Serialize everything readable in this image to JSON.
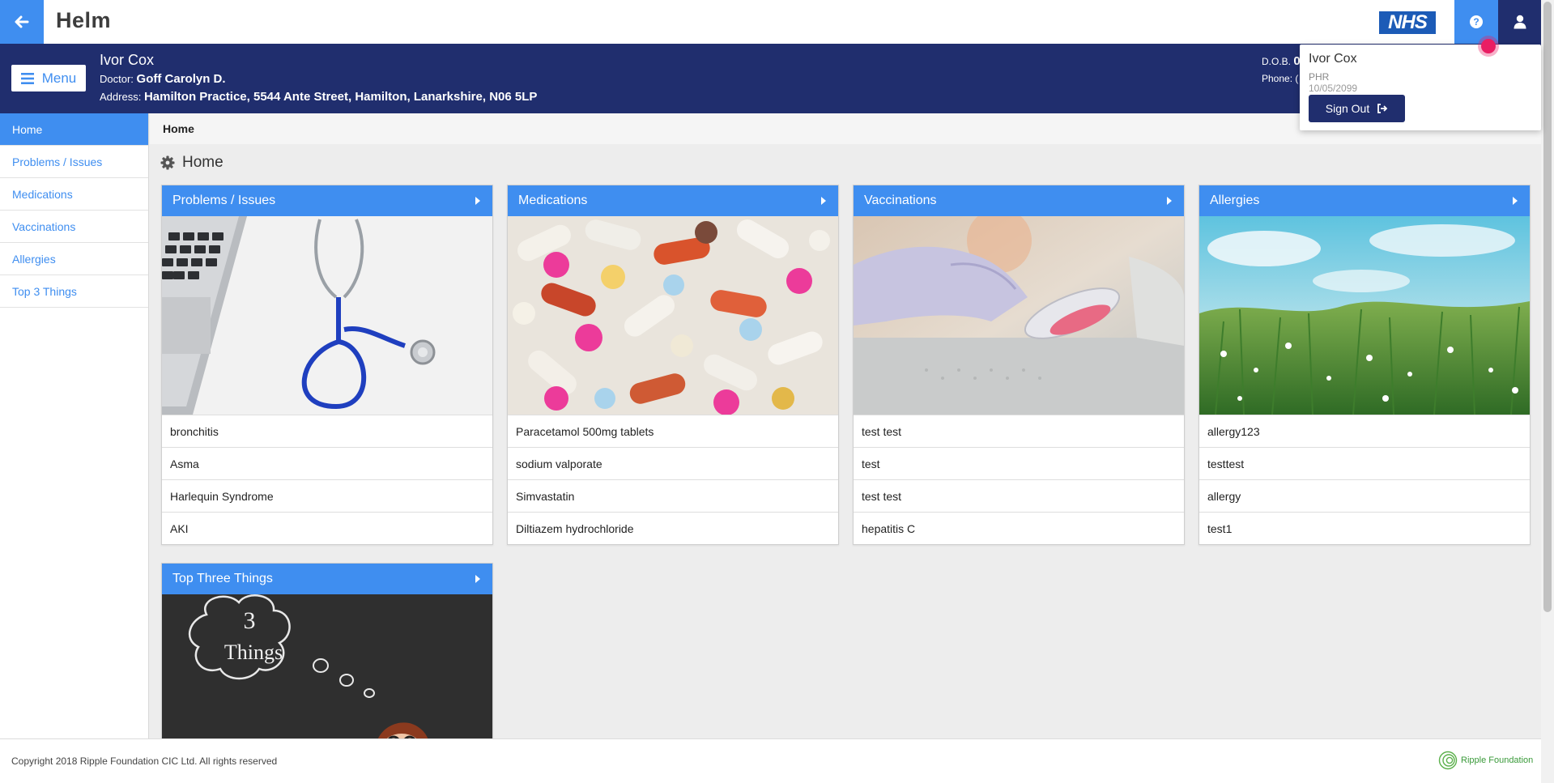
{
  "app": {
    "title": "Helm",
    "logo_text": "NHS"
  },
  "colors": {
    "primary": "#3f8ef0",
    "banner": "#202e6e",
    "accent_dot": "#e91e63"
  },
  "patient": {
    "name": "Ivor Cox",
    "doctor_label": "Doctor:",
    "doctor": "Goff Carolyn D.",
    "address_label": "Address:",
    "address": "Hamilton Practice, 5544 Ante Street, Hamilton, Lanarkshire, N06 5LP",
    "dob_label": "D.O.B.",
    "dob_partial": "0",
    "phone_label": "Phone:",
    "phone_partial": "("
  },
  "menu": {
    "label": "Menu"
  },
  "sidebar": {
    "items": [
      {
        "label": "Home",
        "active": true
      },
      {
        "label": "Problems / Issues"
      },
      {
        "label": "Medications"
      },
      {
        "label": "Vaccinations"
      },
      {
        "label": "Allergies"
      },
      {
        "label": "Top 3 Things"
      }
    ]
  },
  "breadcrumb": "Home",
  "page": {
    "title": "Home",
    "icon": "gear-icon"
  },
  "cards": [
    {
      "title": "Problems / Issues",
      "rows": [
        "bronchitis",
        "Asma",
        "Harlequin Syndrome",
        "AKI"
      ]
    },
    {
      "title": "Medications",
      "rows": [
        "Paracetamol 500mg tablets",
        "sodium valporate",
        "Simvastatin",
        "Diltiazem hydrochloride"
      ]
    },
    {
      "title": "Vaccinations",
      "rows": [
        "test test",
        "test",
        "test test",
        "hepatitis C"
      ]
    },
    {
      "title": "Allergies",
      "rows": [
        "allergy123",
        "testtest",
        "allergy",
        "test1"
      ]
    },
    {
      "title": "Top Three Things",
      "image_text": [
        "3",
        "Things"
      ]
    }
  ],
  "footer": {
    "copyright": "Copyright 2018 Ripple Foundation CIC Ltd. All rights reserved",
    "brand": "Ripple Foundation"
  },
  "user_menu": {
    "name": "Ivor Cox",
    "role": "PHR",
    "date": "10/05/2099",
    "signout_label": "Sign Out"
  }
}
